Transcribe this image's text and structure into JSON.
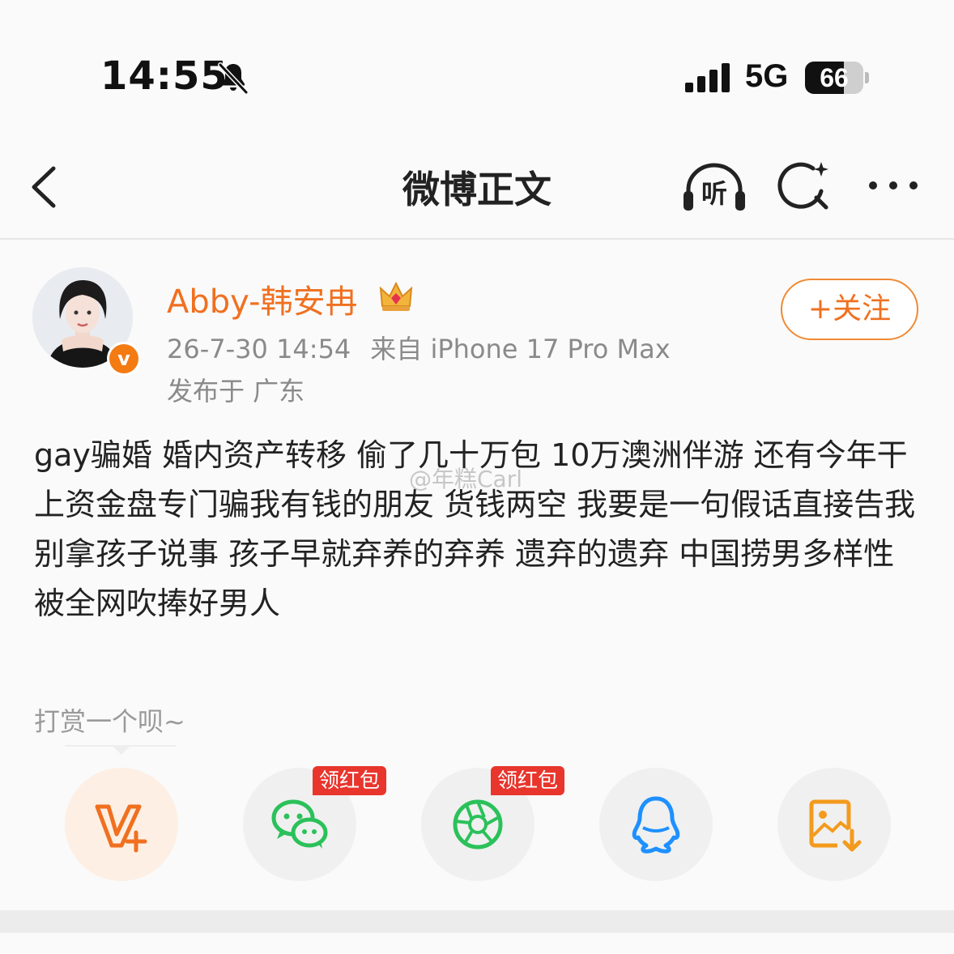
{
  "status_bar": {
    "time": "14:55",
    "network": "5G",
    "battery": "66",
    "battery_level": 0.66,
    "icons": [
      "bell-muted-icon",
      "cellular-signal-icon",
      "battery-icon"
    ]
  },
  "nav": {
    "title": "微博正文",
    "listen_label": "听",
    "icons": [
      "back-icon",
      "listen-icon",
      "search-icon",
      "more-icon"
    ]
  },
  "post": {
    "username": "Abby-韩安冉",
    "date": "26-7-30 14:54",
    "source": "来自 iPhone 17 Pro Max",
    "location": "发布于 广东",
    "follow_label": "+关注",
    "body": "gay骗婚 婚内资产转移 偷了几十万包 10万澳洲伴游 还有今年干上资金盘专门骗我有钱的朋友 货钱两空 我要是一句假话直接告我 别拿孩子说事 孩子早就弃养的弃养 遗弃的遗弃 中国捞男多样性被全网吹捧好男人",
    "watermark": "@年糕Carl"
  },
  "reward": {
    "prompt": "打赏一个呗~"
  },
  "share": {
    "items": [
      {
        "icon": "v-plus-icon"
      },
      {
        "icon": "wechat-icon",
        "badge": "领红包"
      },
      {
        "icon": "moments-icon",
        "badge": "领红包"
      },
      {
        "icon": "qq-icon"
      },
      {
        "icon": "save-image-icon"
      }
    ]
  },
  "colors": {
    "accent": "#f07020",
    "redpacket": "#e8362d",
    "wechat": "#2bc15a",
    "qq": "#1e90ff",
    "background": "#fafafa"
  }
}
